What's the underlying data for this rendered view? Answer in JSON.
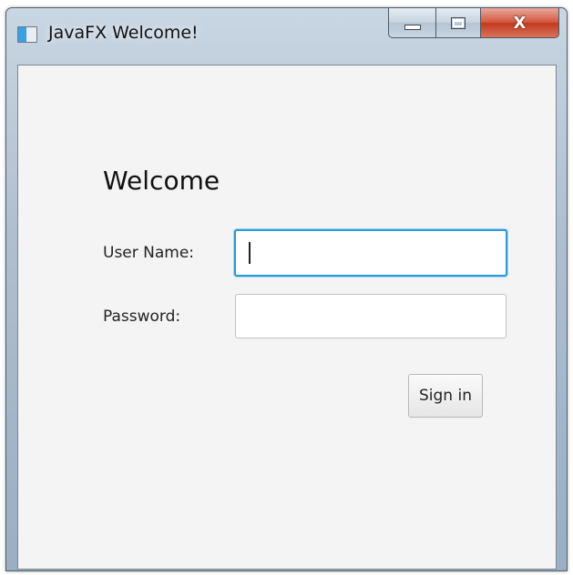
{
  "window": {
    "title": "JavaFX Welcome!",
    "icon": "javafx-app-icon",
    "caption_buttons": {
      "minimize_icon": "minimize-icon",
      "maximize_icon": "maximize-icon",
      "close_icon": "close-icon",
      "close_glyph": "X"
    }
  },
  "form": {
    "heading": "Welcome",
    "username_label": "User Name:",
    "username_value": "",
    "password_label": "Password:",
    "password_value": "",
    "signin_label": "Sign in"
  },
  "colors": {
    "focus_border": "#2a9ad8",
    "close_button": "#c23a20",
    "client_background": "#f4f4f4"
  }
}
